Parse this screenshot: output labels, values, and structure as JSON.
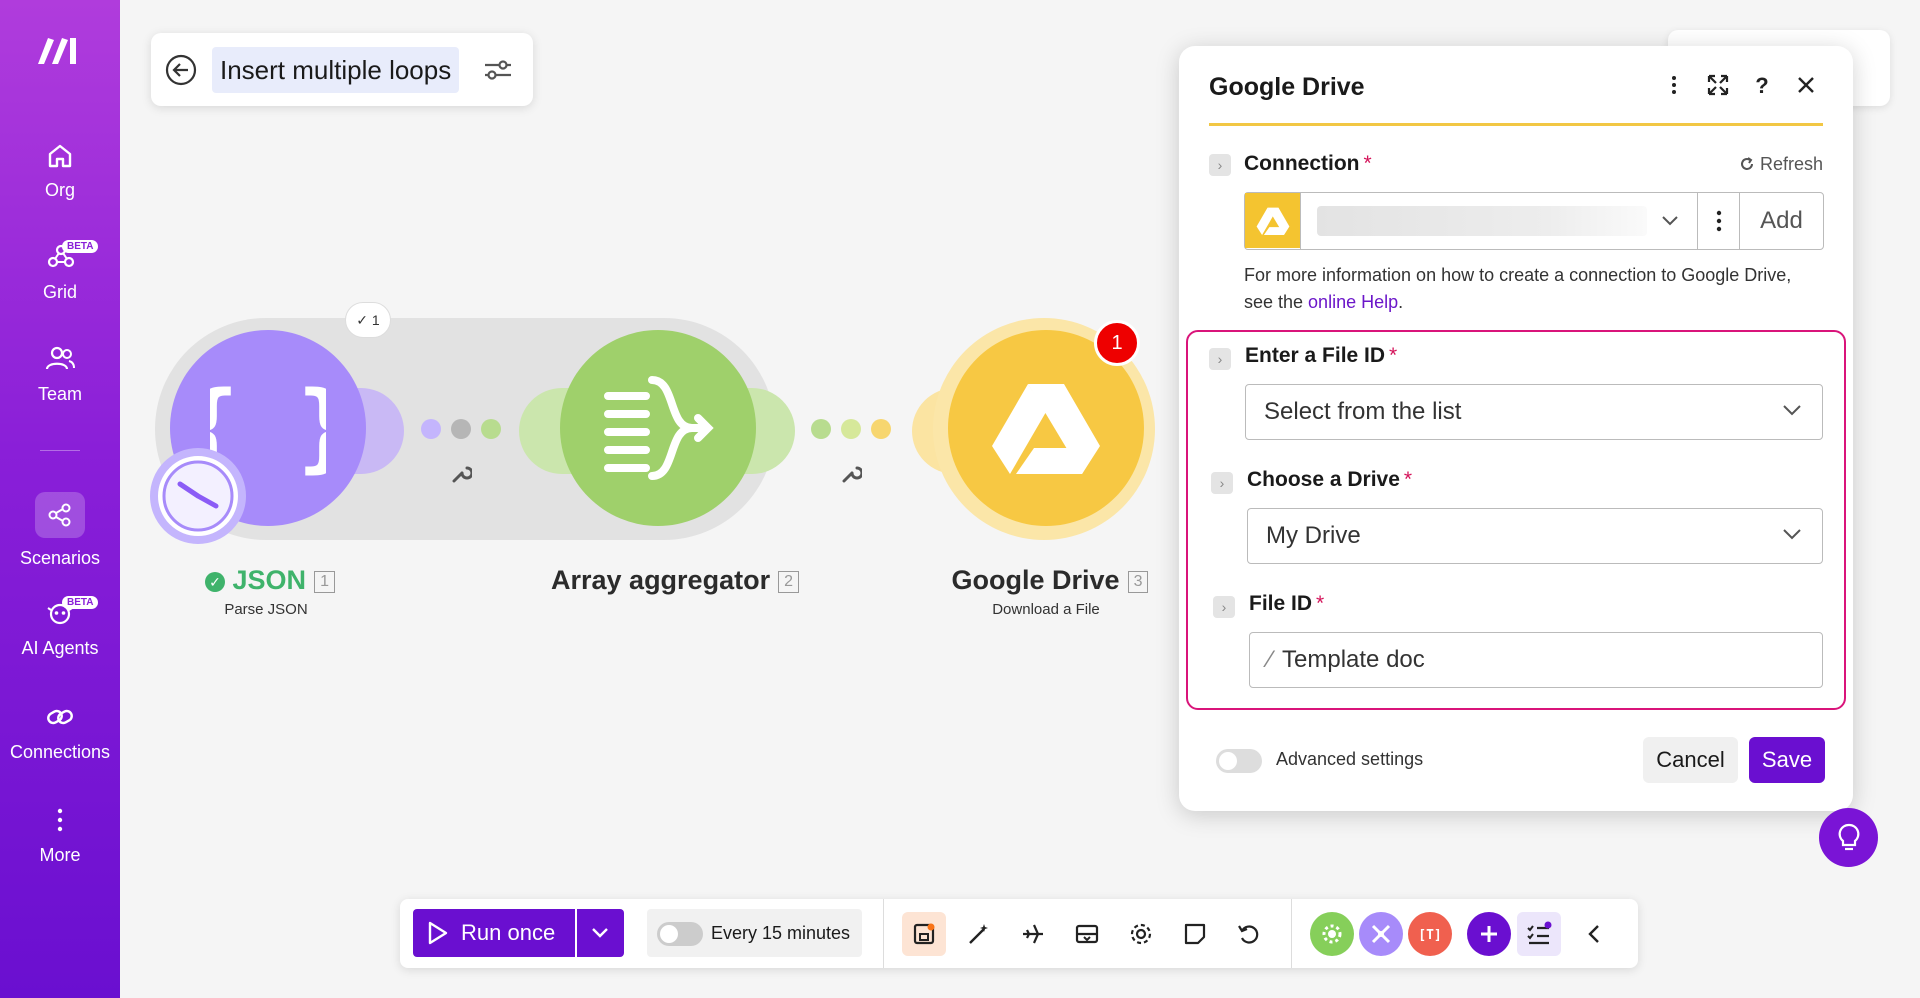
{
  "sidebar": {
    "items": [
      {
        "label": "Org",
        "icon": "home-icon"
      },
      {
        "label": "Grid",
        "icon": "grid-icon",
        "badge": "BETA"
      },
      {
        "label": "Team",
        "icon": "team-icon"
      },
      {
        "label": "Scenarios",
        "icon": "scenarios-icon"
      },
      {
        "label": "AI Agents",
        "icon": "ai-agents-icon",
        "badge": "BETA"
      },
      {
        "label": "Connections",
        "icon": "link-icon"
      },
      {
        "label": "More",
        "icon": "more-vertical-icon"
      }
    ]
  },
  "header": {
    "title": "Insert multiple loops"
  },
  "scenario": {
    "loop_badge": "1",
    "modules": [
      {
        "name": "JSON",
        "number": "1",
        "subtitle": "Parse JSON",
        "color": "#a78bfa"
      },
      {
        "name": "Array aggregator",
        "number": "2",
        "subtitle": "",
        "color": "#9fd06b"
      },
      {
        "name": "Google Drive",
        "number": "3",
        "subtitle": "Download a File",
        "color": "#f7c843"
      }
    ],
    "error_count": "1"
  },
  "panel": {
    "title": "Google Drive",
    "connection": {
      "label": "Connection",
      "refresh": "Refresh",
      "add": "Add"
    },
    "help": {
      "before": "For more information on how to create a connection to Google Drive, see the ",
      "link": "online Help",
      "after": "."
    },
    "fields": {
      "file_id_mode": {
        "label": "Enter a File ID",
        "value": "Select from the list"
      },
      "drive": {
        "label": "Choose a Drive",
        "value": "My Drive"
      },
      "file_id": {
        "label": "File ID",
        "value": "Template doc"
      }
    },
    "advanced_label": "Advanced settings",
    "cancel": "Cancel",
    "save": "Save"
  },
  "toolbar": {
    "run_label": "Run once",
    "schedule_label": "Every 15 minutes"
  },
  "colors": {
    "brand": "#6a0fd0",
    "highlight": "#d9147a",
    "drive_yellow": "#f7c843"
  }
}
